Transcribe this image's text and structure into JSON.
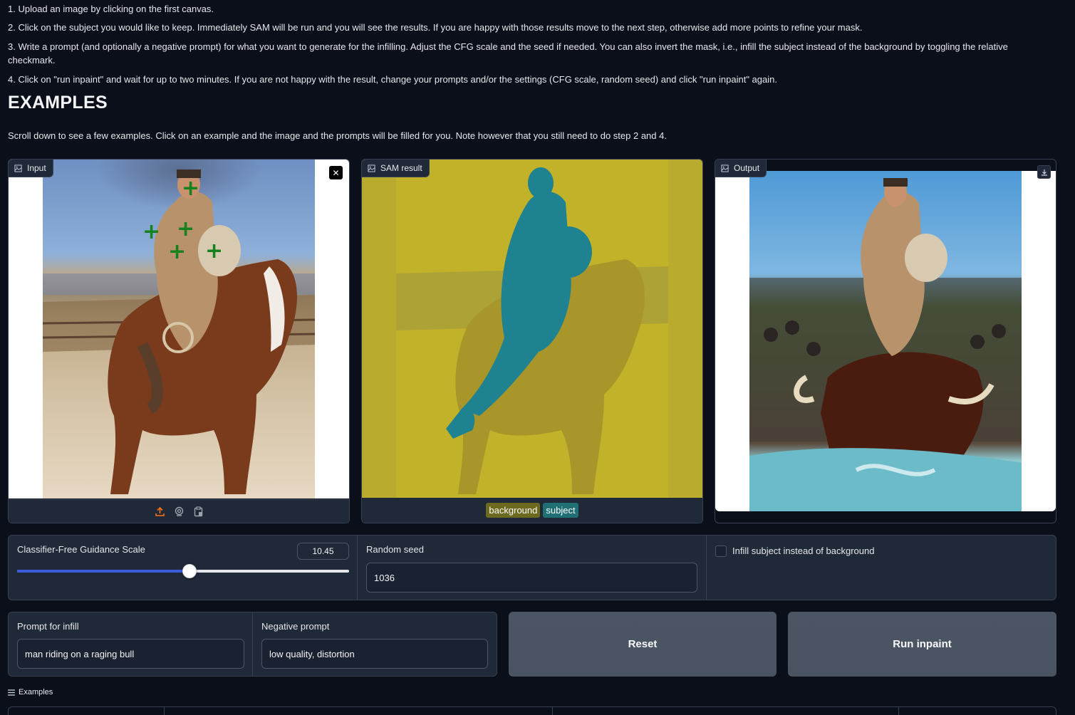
{
  "instructions": [
    "1. Upload an image by clicking on the first canvas.",
    "2. Click on the subject you would like to keep. Immediately SAM will be run and you will see the results. If you are happy with those results move to the next step, otherwise add more points to refine your mask.",
    "3. Write a prompt (and optionally a negative prompt) for what you want to generate for the infilling. Adjust the CFG scale and the seed if needed. You can also invert the mask, i.e., infill the subject instead of the background by toggling the relative checkmark.",
    "4. Click on \"run inpaint\" and wait for up to two minutes. If you are not happy with the result, change your prompts and/or the settings (CFG scale, random seed) and click \"run inpaint\" again."
  ],
  "examples_heading": "EXAMPLES",
  "examples_description": "Scroll down to see a few examples. Click on an example and the image and the prompts will be filled for you. Note however that you still need to do step 2 and 4.",
  "panels": {
    "input": {
      "label": "Input",
      "close": "✕"
    },
    "sam": {
      "label": "SAM result",
      "legend": [
        {
          "label": "background",
          "color": "#6b6a1e"
        },
        {
          "label": "subject",
          "color": "#1f6f74"
        }
      ]
    },
    "output": {
      "label": "Output"
    }
  },
  "controls": {
    "cfg": {
      "label": "Classifier-Free Guidance Scale",
      "value": "10.45",
      "fraction": 0.52
    },
    "seed": {
      "label": "Random seed",
      "value": "1036"
    },
    "invert": {
      "label": "Infill subject instead of background",
      "checked": false
    },
    "prompt": {
      "label": "Prompt for infill",
      "value": "man riding on a raging bull"
    },
    "negative": {
      "label": "Negative prompt",
      "value": "low quality, distortion"
    },
    "reset_label": "Reset",
    "run_label": "Run inpaint"
  },
  "examples_toggle": "Examples",
  "colors": {
    "accent_slider": "#3b5bdb",
    "upload_icon": "#f97316",
    "sam_overlay": "#c5b320",
    "subject_mask": "#1f7f8c"
  }
}
